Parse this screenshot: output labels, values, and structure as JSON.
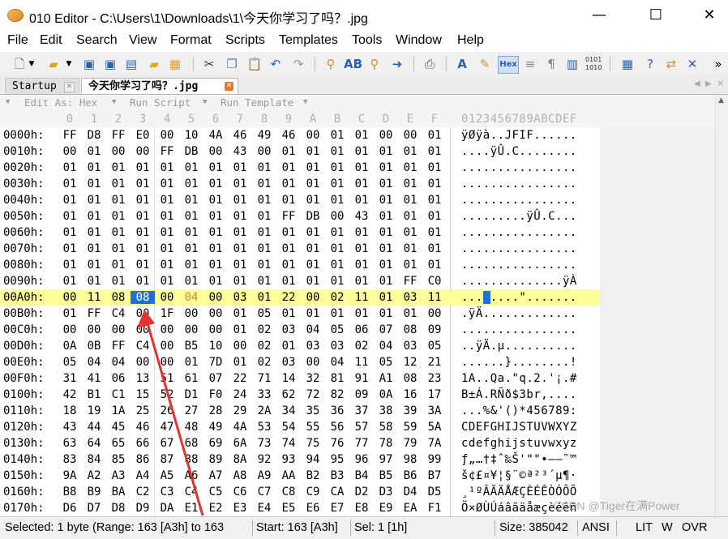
{
  "window": {
    "title": "010 Editor - C:\\Users\\1\\Downloads\\1\\今天你学习了吗？.jpg",
    "minimize": "—",
    "maximize": "☐",
    "close": "✕"
  },
  "menu": [
    "File",
    "Edit",
    "Search",
    "View",
    "Format",
    "Scripts",
    "Templates",
    "Tools",
    "Window",
    "Help"
  ],
  "toolbar": {
    "icons": [
      "new-file-icon",
      "new-dropdown-icon",
      "open-folder-icon",
      "open-dropdown-icon",
      "save-icon",
      "save-as-icon",
      "save-all-icon",
      "open-project-icon",
      "open-templates-icon",
      "cut-icon",
      "copy-icon",
      "paste-icon",
      "undo-icon",
      "redo-icon",
      "find-icon",
      "find-replace-icon",
      "find-in-files-icon",
      "goto-icon",
      "print-icon",
      "font-icon",
      "highlight-icon",
      "hex-mode-icon",
      "text-mode-icon",
      "paragraph-icon",
      "columns-icon",
      "binary-icon",
      "calculator-icon",
      "inspector-icon",
      "compare-icon",
      "tools-icon",
      "more-icon"
    ],
    "hex_label": "Hex",
    "more": "»"
  },
  "tabs": [
    {
      "label": "Startup"
    },
    {
      "label": "今天你学习了吗？.jpg"
    }
  ],
  "editbar": {
    "edit_as": "Edit As: Hex",
    "run_script": "Run Script",
    "run_template": "Run Template"
  },
  "hex_header": {
    "columns": [
      "0",
      "1",
      "2",
      "3",
      "4",
      "5",
      "6",
      "7",
      "8",
      "9",
      "A",
      "B",
      "C",
      "D",
      "E",
      "F"
    ],
    "ascii": "0123456789ABCDEF"
  },
  "rows": [
    {
      "addr": "0000h:",
      "bytes": [
        "FF",
        "D8",
        "FF",
        "E0",
        "00",
        "10",
        "4A",
        "46",
        "49",
        "46",
        "00",
        "01",
        "01",
        "00",
        "00",
        "01"
      ],
      "ascii": "ÿØÿà..JFIF......"
    },
    {
      "addr": "0010h:",
      "bytes": [
        "00",
        "01",
        "00",
        "00",
        "FF",
        "DB",
        "00",
        "43",
        "00",
        "01",
        "01",
        "01",
        "01",
        "01",
        "01",
        "01"
      ],
      "ascii": "....ÿÛ.C........"
    },
    {
      "addr": "0020h:",
      "bytes": [
        "01",
        "01",
        "01",
        "01",
        "01",
        "01",
        "01",
        "01",
        "01",
        "01",
        "01",
        "01",
        "01",
        "01",
        "01",
        "01"
      ],
      "ascii": "................"
    },
    {
      "addr": "0030h:",
      "bytes": [
        "01",
        "01",
        "01",
        "01",
        "01",
        "01",
        "01",
        "01",
        "01",
        "01",
        "01",
        "01",
        "01",
        "01",
        "01",
        "01"
      ],
      "ascii": "................"
    },
    {
      "addr": "0040h:",
      "bytes": [
        "01",
        "01",
        "01",
        "01",
        "01",
        "01",
        "01",
        "01",
        "01",
        "01",
        "01",
        "01",
        "01",
        "01",
        "01",
        "01"
      ],
      "ascii": "................"
    },
    {
      "addr": "0050h:",
      "bytes": [
        "01",
        "01",
        "01",
        "01",
        "01",
        "01",
        "01",
        "01",
        "01",
        "FF",
        "DB",
        "00",
        "43",
        "01",
        "01",
        "01"
      ],
      "ascii": ".........ÿÛ.C..."
    },
    {
      "addr": "0060h:",
      "bytes": [
        "01",
        "01",
        "01",
        "01",
        "01",
        "01",
        "01",
        "01",
        "01",
        "01",
        "01",
        "01",
        "01",
        "01",
        "01",
        "01"
      ],
      "ascii": "................"
    },
    {
      "addr": "0070h:",
      "bytes": [
        "01",
        "01",
        "01",
        "01",
        "01",
        "01",
        "01",
        "01",
        "01",
        "01",
        "01",
        "01",
        "01",
        "01",
        "01",
        "01"
      ],
      "ascii": "................"
    },
    {
      "addr": "0080h:",
      "bytes": [
        "01",
        "01",
        "01",
        "01",
        "01",
        "01",
        "01",
        "01",
        "01",
        "01",
        "01",
        "01",
        "01",
        "01",
        "01",
        "01"
      ],
      "ascii": "................"
    },
    {
      "addr": "0090h:",
      "bytes": [
        "01",
        "01",
        "01",
        "01",
        "01",
        "01",
        "01",
        "01",
        "01",
        "01",
        "01",
        "01",
        "01",
        "01",
        "FF",
        "C0"
      ],
      "ascii": "..............ÿÀ"
    },
    {
      "addr": "00A0h:",
      "bytes": [
        "00",
        "11",
        "08",
        "08",
        "00",
        "04",
        "00",
        "03",
        "01",
        "22",
        "00",
        "02",
        "11",
        "01",
        "03",
        "11"
      ],
      "ascii": "........\"......."
    },
    {
      "addr": "00B0h:",
      "bytes": [
        "01",
        "FF",
        "C4",
        "00",
        "1F",
        "00",
        "00",
        "01",
        "05",
        "01",
        "01",
        "01",
        "01",
        "01",
        "01",
        "00"
      ],
      "ascii": ".ÿÄ............."
    },
    {
      "addr": "00C0h:",
      "bytes": [
        "00",
        "00",
        "00",
        "00",
        "00",
        "00",
        "00",
        "01",
        "02",
        "03",
        "04",
        "05",
        "06",
        "07",
        "08",
        "09"
      ],
      "ascii": "................"
    },
    {
      "addr": "00D0h:",
      "bytes": [
        "0A",
        "0B",
        "FF",
        "C4",
        "00",
        "B5",
        "10",
        "00",
        "02",
        "01",
        "03",
        "03",
        "02",
        "04",
        "03",
        "05"
      ],
      "ascii": "..ÿÄ.µ.........."
    },
    {
      "addr": "00E0h:",
      "bytes": [
        "05",
        "04",
        "04",
        "00",
        "00",
        "01",
        "7D",
        "01",
        "02",
        "03",
        "00",
        "04",
        "11",
        "05",
        "12",
        "21"
      ],
      "ascii": "......}........!"
    },
    {
      "addr": "00F0h:",
      "bytes": [
        "31",
        "41",
        "06",
        "13",
        "51",
        "61",
        "07",
        "22",
        "71",
        "14",
        "32",
        "81",
        "91",
        "A1",
        "08",
        "23"
      ],
      "ascii": "1A..Qa.\"q.2.'¡.#"
    },
    {
      "addr": "0100h:",
      "bytes": [
        "42",
        "B1",
        "C1",
        "15",
        "52",
        "D1",
        "F0",
        "24",
        "33",
        "62",
        "72",
        "82",
        "09",
        "0A",
        "16",
        "17"
      ],
      "ascii": "B±Á.RÑð$3br,...."
    },
    {
      "addr": "0110h:",
      "bytes": [
        "18",
        "19",
        "1A",
        "25",
        "26",
        "27",
        "28",
        "29",
        "2A",
        "34",
        "35",
        "36",
        "37",
        "38",
        "39",
        "3A"
      ],
      "ascii": "...%&'()*456789:"
    },
    {
      "addr": "0120h:",
      "bytes": [
        "43",
        "44",
        "45",
        "46",
        "47",
        "48",
        "49",
        "4A",
        "53",
        "54",
        "55",
        "56",
        "57",
        "58",
        "59",
        "5A"
      ],
      "ascii": "CDEFGHIJSTUVWXYZ"
    },
    {
      "addr": "0130h:",
      "bytes": [
        "63",
        "64",
        "65",
        "66",
        "67",
        "68",
        "69",
        "6A",
        "73",
        "74",
        "75",
        "76",
        "77",
        "78",
        "79",
        "7A"
      ],
      "ascii": "cdefghijstuvwxyz"
    },
    {
      "addr": "0140h:",
      "bytes": [
        "83",
        "84",
        "85",
        "86",
        "87",
        "88",
        "89",
        "8A",
        "92",
        "93",
        "94",
        "95",
        "96",
        "97",
        "98",
        "99"
      ],
      "ascii": "ƒ„…†‡ˆ‰Š'\"\"•–—˜™"
    },
    {
      "addr": "0150h:",
      "bytes": [
        "9A",
        "A2",
        "A3",
        "A4",
        "A5",
        "A6",
        "A7",
        "A8",
        "A9",
        "AA",
        "B2",
        "B3",
        "B4",
        "B5",
        "B6",
        "B7"
      ],
      "ascii": "š¢£¤¥¦§¨©ª²³´µ¶·"
    },
    {
      "addr": "0160h:",
      "bytes": [
        "B8",
        "B9",
        "BA",
        "C2",
        "C3",
        "C4",
        "C5",
        "C6",
        "C7",
        "C8",
        "C9",
        "CA",
        "D2",
        "D3",
        "D4",
        "D5"
      ],
      "ascii": "¸¹ºÂÃÄÅÆÇÈÉÊÒÓÔÕ"
    },
    {
      "addr": "0170h:",
      "bytes": [
        "D6",
        "D7",
        "D8",
        "D9",
        "DA",
        "E1",
        "E2",
        "E3",
        "E4",
        "E5",
        "E6",
        "E7",
        "E8",
        "E9",
        "EA",
        "F1"
      ],
      "ascii": "Ö×ØÙÚáâãäåæçèéêñ"
    }
  ],
  "selection": {
    "row": 10,
    "col": 3
  },
  "status": {
    "selected": "Selected: 1 byte (Range: 163 [A3h] to 163",
    "start": "Start: 163 [A3h]",
    "sel": "Sel: 1 [1h]",
    "size": "Size: 385042",
    "encoding": "ANSI",
    "lit": "LIT",
    "w": "W",
    "ovr": "OVR"
  },
  "watermark": "CSDN @Tiger在满Power",
  "colors": {
    "highlight_row": "#ffff99",
    "selection": "#1f6fd8",
    "arrow": "#e8322f",
    "modified_bytes": "#d08a20"
  }
}
